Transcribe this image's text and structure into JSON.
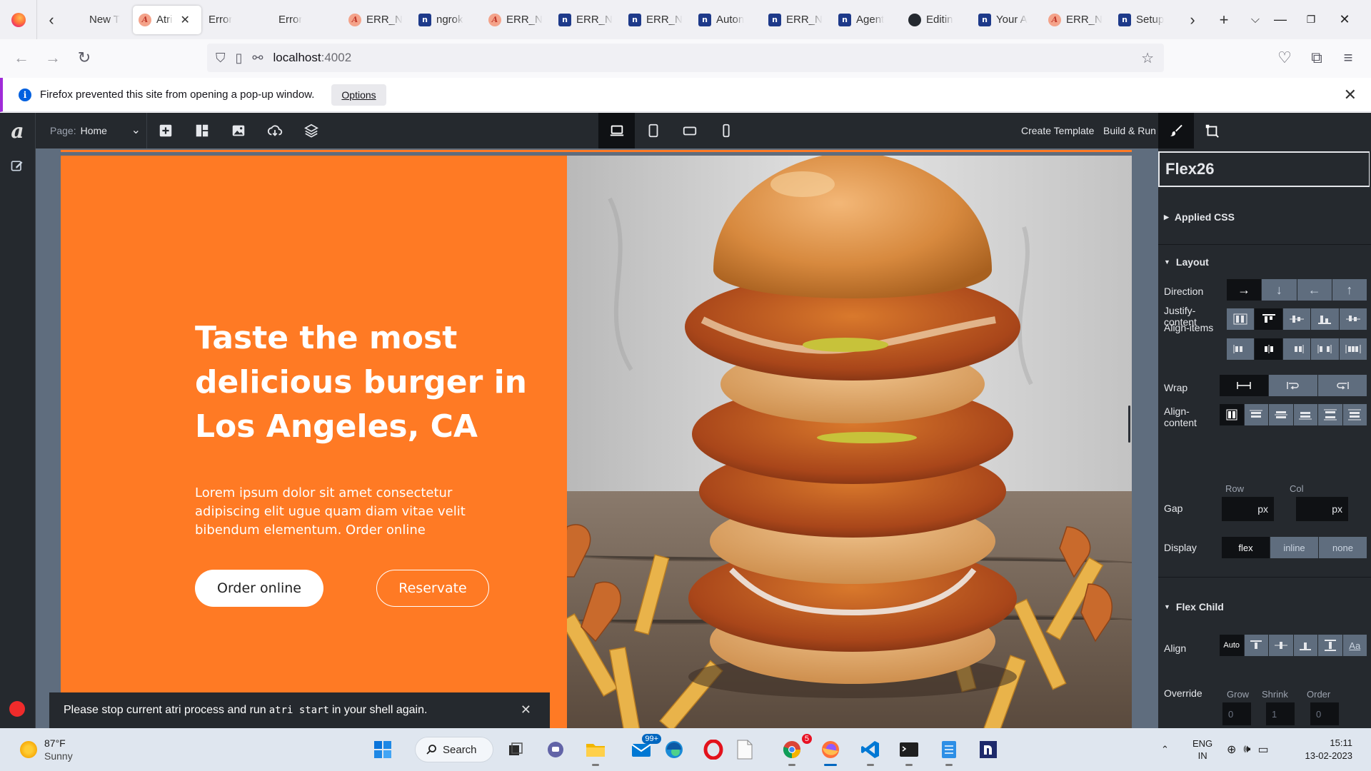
{
  "browser": {
    "tabs": [
      {
        "label": "New T",
        "icon": "firefox-newtab-icon",
        "active": false
      },
      {
        "label": "Atri",
        "icon": "atri-favicon",
        "active": true
      },
      {
        "label": "Error",
        "icon": "",
        "active": false
      },
      {
        "label": "Error",
        "icon": "",
        "active": false
      },
      {
        "label": "ERR_N",
        "icon": "atri-favicon",
        "active": false
      },
      {
        "label": "ngrok",
        "icon": "n-favicon",
        "active": false
      },
      {
        "label": "ERR_N",
        "icon": "atri-favicon",
        "active": false
      },
      {
        "label": "ERR_N",
        "icon": "n-favicon",
        "active": false
      },
      {
        "label": "ERR_N",
        "icon": "n-favicon",
        "active": false
      },
      {
        "label": "Auton",
        "icon": "n-favicon",
        "active": false
      },
      {
        "label": "ERR_N",
        "icon": "n-favicon",
        "active": false
      },
      {
        "label": "Agent",
        "icon": "n-favicon",
        "active": false
      },
      {
        "label": "Editin",
        "icon": "github-favicon",
        "active": false
      },
      {
        "label": "Your A",
        "icon": "n-favicon",
        "active": false
      },
      {
        "label": "ERR_N",
        "icon": "atri-favicon",
        "active": false
      },
      {
        "label": "Setup",
        "icon": "n-favicon",
        "active": false
      }
    ],
    "url_host": "localhost",
    "url_port": ":4002",
    "notification": {
      "text": "Firefox prevented this site from opening a pop-up window.",
      "options_label": "Options"
    }
  },
  "editor": {
    "logo": "a",
    "page_label": "Page:",
    "page_value": "Home",
    "create_template": "Create Template",
    "build_run": "Build & Run"
  },
  "hero": {
    "title": "Taste the most delicious burger in Los Angeles, CA",
    "description": "Lorem ipsum dolor sit amet consectetur adipiscing elit ugue quam diam vitae velit bibendum elementum. Order online",
    "primary_button": "Order online",
    "secondary_button": "Reservate",
    "accent_color": "#ff7a24"
  },
  "toast": {
    "text_before": "Please stop current atri process and run",
    "code": "atri start",
    "text_after": "in your shell again."
  },
  "panel": {
    "title": "Flex26",
    "applied_css": "Applied CSS",
    "layout_title": "Layout",
    "direction_label": "Direction",
    "direction_options": [
      "→",
      "↓",
      "←",
      "↑"
    ],
    "align_items_label": "Align-items",
    "justify_label": "Justify-content",
    "wrap_label": "Wrap",
    "align_content_label": "Align-content",
    "gap_label": "Gap",
    "gap_row": "Row",
    "gap_col": "Col",
    "gap_unit": "px",
    "display_label": "Display",
    "display_options": [
      "flex",
      "inline",
      "none"
    ],
    "flex_child_title": "Flex Child",
    "align_label": "Align",
    "align_auto": "Auto",
    "align_text_option": "Aa",
    "override_label": "Override",
    "grow_label": "Grow",
    "shrink_label": "Shrink",
    "order_label": "Order",
    "grow_value": "0",
    "shrink_value": "1",
    "order_value": "0"
  },
  "taskbar": {
    "temperature": "87°F",
    "condition": "Sunny",
    "search_label": "Search",
    "mail_badge": "99+",
    "chrome_badge": "5",
    "lang": "ENG",
    "region": "IN",
    "time": "15:11",
    "date": "13-02-2023"
  }
}
